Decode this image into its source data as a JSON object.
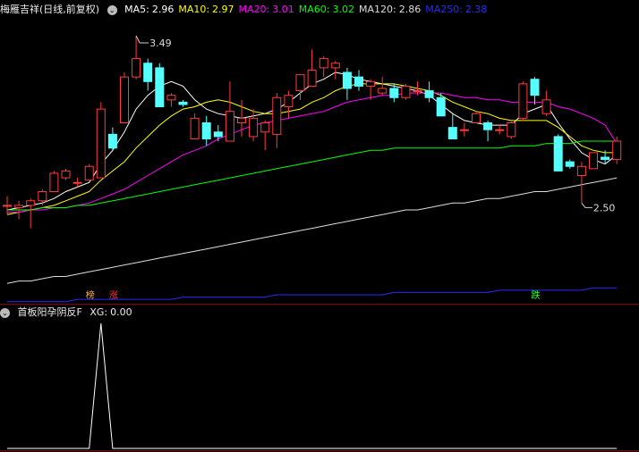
{
  "main": {
    "title": "梅雁吉祥(日线,前复权)",
    "indicators": [
      {
        "label": "MA5:",
        "value": "2.96",
        "color": "#ffffff"
      },
      {
        "label": "MA10:",
        "value": "2.97",
        "color": "#ffff00"
      },
      {
        "label": "MA20:",
        "value": "3.01",
        "color": "#ff00ff"
      },
      {
        "label": "MA60:",
        "value": "3.02",
        "color": "#00ff00"
      },
      {
        "label": "MA120:",
        "value": "2.86",
        "color": "#dddddd"
      },
      {
        "label": "MA250:",
        "value": "2.38",
        "color": "#2a2aff"
      }
    ],
    "high_label": "3.49",
    "low_label": "2.50",
    "tags": [
      {
        "text": "榜",
        "color": "#ffaa44"
      },
      {
        "text": "涨",
        "color": "#ff3333"
      },
      {
        "text": "跌",
        "color": "#33ff33"
      }
    ]
  },
  "sub": {
    "title": "首板阳孕阴反F",
    "xg_label": "XG:",
    "xg_value": "0.00",
    "spike_value": 1
  },
  "colors": {
    "up": "#ff3b3b",
    "down": "#54ffff",
    "grid": "#8a0000"
  },
  "chart_data": {
    "type": "candlestick",
    "ylim": [
      2.35,
      3.55
    ],
    "candles": [
      [
        2.74,
        2.78,
        2.7,
        2.74
      ],
      [
        2.73,
        2.76,
        2.68,
        2.74
      ],
      [
        2.74,
        2.77,
        2.64,
        2.76
      ],
      [
        2.76,
        2.81,
        2.74,
        2.8
      ],
      [
        2.8,
        2.89,
        2.8,
        2.88
      ],
      [
        2.86,
        2.9,
        2.85,
        2.89
      ],
      [
        2.84,
        2.86,
        2.82,
        2.84
      ],
      [
        2.85,
        2.92,
        2.85,
        2.91
      ],
      [
        2.86,
        3.19,
        2.86,
        3.16
      ],
      [
        3.05,
        3.08,
        2.98,
        2.99
      ],
      [
        3.1,
        3.32,
        3.1,
        3.3
      ],
      [
        3.3,
        3.48,
        3.29,
        3.38
      ],
      [
        3.36,
        3.38,
        3.24,
        3.28
      ],
      [
        3.34,
        3.36,
        3.17,
        3.17
      ],
      [
        3.2,
        3.23,
        3.17,
        3.22
      ],
      [
        3.19,
        3.2,
        3.17,
        3.18
      ],
      [
        3.03,
        3.14,
        3.03,
        3.12
      ],
      [
        3.1,
        3.13,
        3.0,
        3.03
      ],
      [
        3.06,
        3.09,
        3.02,
        3.04
      ],
      [
        3.02,
        3.28,
        3.02,
        3.15
      ],
      [
        3.1,
        3.2,
        3.04,
        3.12
      ],
      [
        3.04,
        3.16,
        3.02,
        3.12
      ],
      [
        3.06,
        3.11,
        2.98,
        3.1
      ],
      [
        3.05,
        3.23,
        2.99,
        3.21
      ],
      [
        3.17,
        3.24,
        3.12,
        3.22
      ],
      [
        3.24,
        3.3,
        3.2,
        3.31
      ],
      [
        3.26,
        3.42,
        3.26,
        3.33
      ],
      [
        3.34,
        3.39,
        3.3,
        3.38
      ],
      [
        3.34,
        3.37,
        3.29,
        3.36
      ],
      [
        3.32,
        3.34,
        3.2,
        3.25
      ],
      [
        3.3,
        3.33,
        3.24,
        3.26
      ],
      [
        3.26,
        3.29,
        3.2,
        3.28
      ],
      [
        3.23,
        3.3,
        3.22,
        3.25
      ],
      [
        3.25,
        3.27,
        3.19,
        3.21
      ],
      [
        3.21,
        3.27,
        3.2,
        3.26
      ],
      [
        3.24,
        3.28,
        3.22,
        3.24
      ],
      [
        3.24,
        3.28,
        3.19,
        3.21
      ],
      [
        3.21,
        3.23,
        3.14,
        3.13
      ],
      [
        3.08,
        3.14,
        3.03,
        3.03
      ],
      [
        3.07,
        3.1,
        3.04,
        3.07
      ],
      [
        3.1,
        3.15,
        3.1,
        3.14
      ],
      [
        3.1,
        3.11,
        3.02,
        3.07
      ],
      [
        3.07,
        3.09,
        3.05,
        3.07
      ],
      [
        3.04,
        3.11,
        3.03,
        3.1
      ],
      [
        3.12,
        3.28,
        3.11,
        3.27
      ],
      [
        3.29,
        3.3,
        3.18,
        3.22
      ],
      [
        3.14,
        3.24,
        3.13,
        3.2
      ],
      [
        3.04,
        3.05,
        2.91,
        2.89
      ],
      [
        2.93,
        2.94,
        2.9,
        2.91
      ],
      [
        2.87,
        2.93,
        2.75,
        2.91
      ],
      [
        2.9,
        2.97,
        2.9,
        2.97
      ],
      [
        2.95,
        2.98,
        2.92,
        2.94
      ],
      [
        2.94,
        3.04,
        2.92,
        3.02
      ]
    ],
    "ma": [
      {
        "name": "MA5",
        "color": "#ffffff",
        "values": [
          2.72,
          2.73,
          2.74,
          2.75,
          2.77,
          2.8,
          2.82,
          2.84,
          2.92,
          2.98,
          3.06,
          3.16,
          3.22,
          3.26,
          3.28,
          3.26,
          3.2,
          3.16,
          3.14,
          3.13,
          3.12,
          3.13,
          3.14,
          3.16,
          3.19,
          3.23,
          3.27,
          3.29,
          3.32,
          3.31,
          3.29,
          3.28,
          3.27,
          3.26,
          3.25,
          3.24,
          3.22,
          3.18,
          3.14,
          3.11,
          3.1,
          3.09,
          3.09,
          3.09,
          3.14,
          3.16,
          3.18,
          3.1,
          3.03,
          2.97,
          2.94,
          2.92,
          2.96
        ]
      },
      {
        "name": "MA10",
        "color": "#ffff00",
        "values": [
          2.7,
          2.71,
          2.72,
          2.73,
          2.74,
          2.76,
          2.78,
          2.8,
          2.85,
          2.89,
          2.93,
          2.99,
          3.04,
          3.09,
          3.13,
          3.16,
          3.17,
          3.19,
          3.2,
          3.19,
          3.17,
          3.15,
          3.14,
          3.14,
          3.15,
          3.16,
          3.19,
          3.21,
          3.24,
          3.26,
          3.27,
          3.27,
          3.27,
          3.27,
          3.26,
          3.25,
          3.24,
          3.22,
          3.19,
          3.17,
          3.15,
          3.14,
          3.12,
          3.11,
          3.11,
          3.11,
          3.11,
          3.08,
          3.04,
          3.0,
          2.98,
          2.97,
          2.97
        ]
      },
      {
        "name": "MA20",
        "color": "#ff00ff",
        "values": [
          2.71,
          2.71,
          2.72,
          2.72,
          2.73,
          2.73,
          2.74,
          2.75,
          2.77,
          2.79,
          2.81,
          2.84,
          2.87,
          2.9,
          2.93,
          2.96,
          2.98,
          3.0,
          3.03,
          3.05,
          3.07,
          3.09,
          3.1,
          3.11,
          3.12,
          3.13,
          3.14,
          3.15,
          3.17,
          3.19,
          3.2,
          3.21,
          3.22,
          3.22,
          3.23,
          3.23,
          3.23,
          3.23,
          3.22,
          3.21,
          3.21,
          3.2,
          3.2,
          3.19,
          3.19,
          3.19,
          3.19,
          3.17,
          3.16,
          3.14,
          3.12,
          3.09,
          3.01
        ]
      },
      {
        "name": "MA60",
        "color": "#00ff00",
        "values": [
          2.72,
          2.72,
          2.72,
          2.73,
          2.73,
          2.73,
          2.74,
          2.74,
          2.75,
          2.76,
          2.77,
          2.78,
          2.79,
          2.8,
          2.81,
          2.82,
          2.83,
          2.84,
          2.85,
          2.86,
          2.87,
          2.88,
          2.89,
          2.9,
          2.91,
          2.92,
          2.93,
          2.94,
          2.95,
          2.96,
          2.97,
          2.98,
          2.98,
          2.99,
          2.99,
          2.99,
          2.99,
          2.99,
          2.99,
          2.99,
          2.99,
          2.99,
          2.99,
          3.0,
          3.0,
          3.0,
          3.01,
          3.01,
          3.01,
          3.02,
          3.02,
          3.02,
          3.02
        ]
      },
      {
        "name": "MA120",
        "color": "#dddddd",
        "values": [
          2.4,
          2.41,
          2.41,
          2.42,
          2.43,
          2.43,
          2.44,
          2.45,
          2.46,
          2.47,
          2.48,
          2.49,
          2.5,
          2.51,
          2.52,
          2.53,
          2.54,
          2.55,
          2.56,
          2.57,
          2.58,
          2.59,
          2.6,
          2.61,
          2.62,
          2.63,
          2.64,
          2.65,
          2.66,
          2.67,
          2.68,
          2.69,
          2.7,
          2.71,
          2.72,
          2.72,
          2.73,
          2.74,
          2.75,
          2.75,
          2.76,
          2.77,
          2.77,
          2.78,
          2.79,
          2.8,
          2.8,
          2.81,
          2.82,
          2.83,
          2.84,
          2.85,
          2.86
        ]
      },
      {
        "name": "MA250",
        "color": "#2a2aff",
        "values": [
          2.32,
          2.32,
          2.32,
          2.32,
          2.32,
          2.32,
          2.33,
          2.33,
          2.33,
          2.33,
          2.33,
          2.33,
          2.33,
          2.33,
          2.33,
          2.34,
          2.34,
          2.34,
          2.34,
          2.34,
          2.34,
          2.34,
          2.34,
          2.35,
          2.35,
          2.35,
          2.35,
          2.35,
          2.35,
          2.35,
          2.35,
          2.35,
          2.35,
          2.36,
          2.36,
          2.36,
          2.36,
          2.36,
          2.36,
          2.36,
          2.36,
          2.36,
          2.37,
          2.37,
          2.37,
          2.37,
          2.37,
          2.37,
          2.37,
          2.37,
          2.38,
          2.38,
          2.38
        ]
      }
    ],
    "xg": [
      0,
      0,
      0,
      0,
      0,
      0,
      0,
      0,
      1,
      0,
      0,
      0,
      0,
      0,
      0,
      0,
      0,
      0,
      0,
      0,
      0,
      0,
      0,
      0,
      0,
      0,
      0,
      0,
      0,
      0,
      0,
      0,
      0,
      0,
      0,
      0,
      0,
      0,
      0,
      0,
      0,
      0,
      0,
      0,
      0,
      0,
      0,
      0,
      0,
      0,
      0,
      0,
      0
    ],
    "tag_candles": [
      7,
      9,
      45
    ],
    "high_candle": 11,
    "low_candle": 49
  }
}
